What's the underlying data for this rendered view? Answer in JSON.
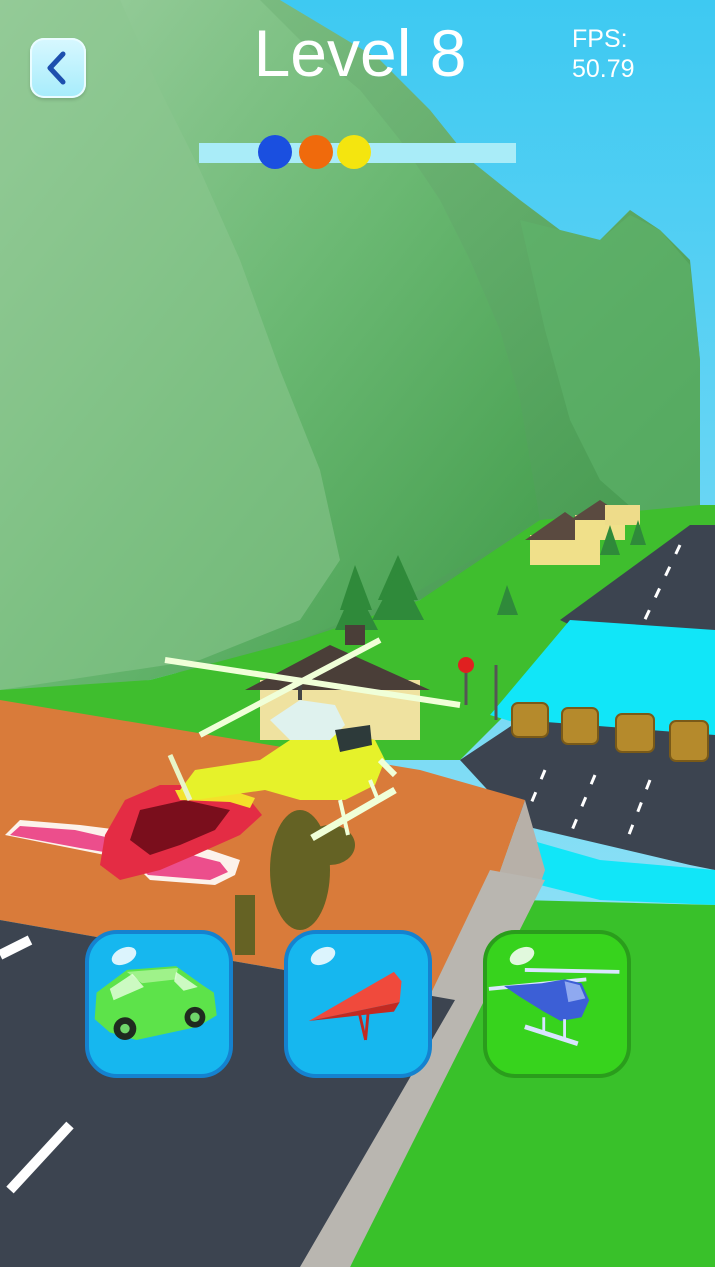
{
  "hud": {
    "back_icon": "chevron-left-icon",
    "level_label": "Level 8",
    "fps_label": "FPS:",
    "fps_value": "50.79"
  },
  "progress": {
    "colors": [
      "#1a4fe0",
      "#f06a0c",
      "#f4e50f"
    ],
    "bar_color": "#a9ecf8"
  },
  "vehicles": [
    {
      "name": "car",
      "icon": "car-icon",
      "color": "#5de34a",
      "selected": false
    },
    {
      "name": "glider",
      "icon": "hang-glider-icon",
      "color": "#f04a3c",
      "selected": false
    },
    {
      "name": "helicopter",
      "icon": "helicopter-icon",
      "color": "#3c5fd6",
      "selected": true
    }
  ],
  "scene": {
    "player_vehicle": "helicopter",
    "player_color": "#e8f52a",
    "opponent_vehicle": "plane",
    "opponent_color": "#e8273c"
  }
}
